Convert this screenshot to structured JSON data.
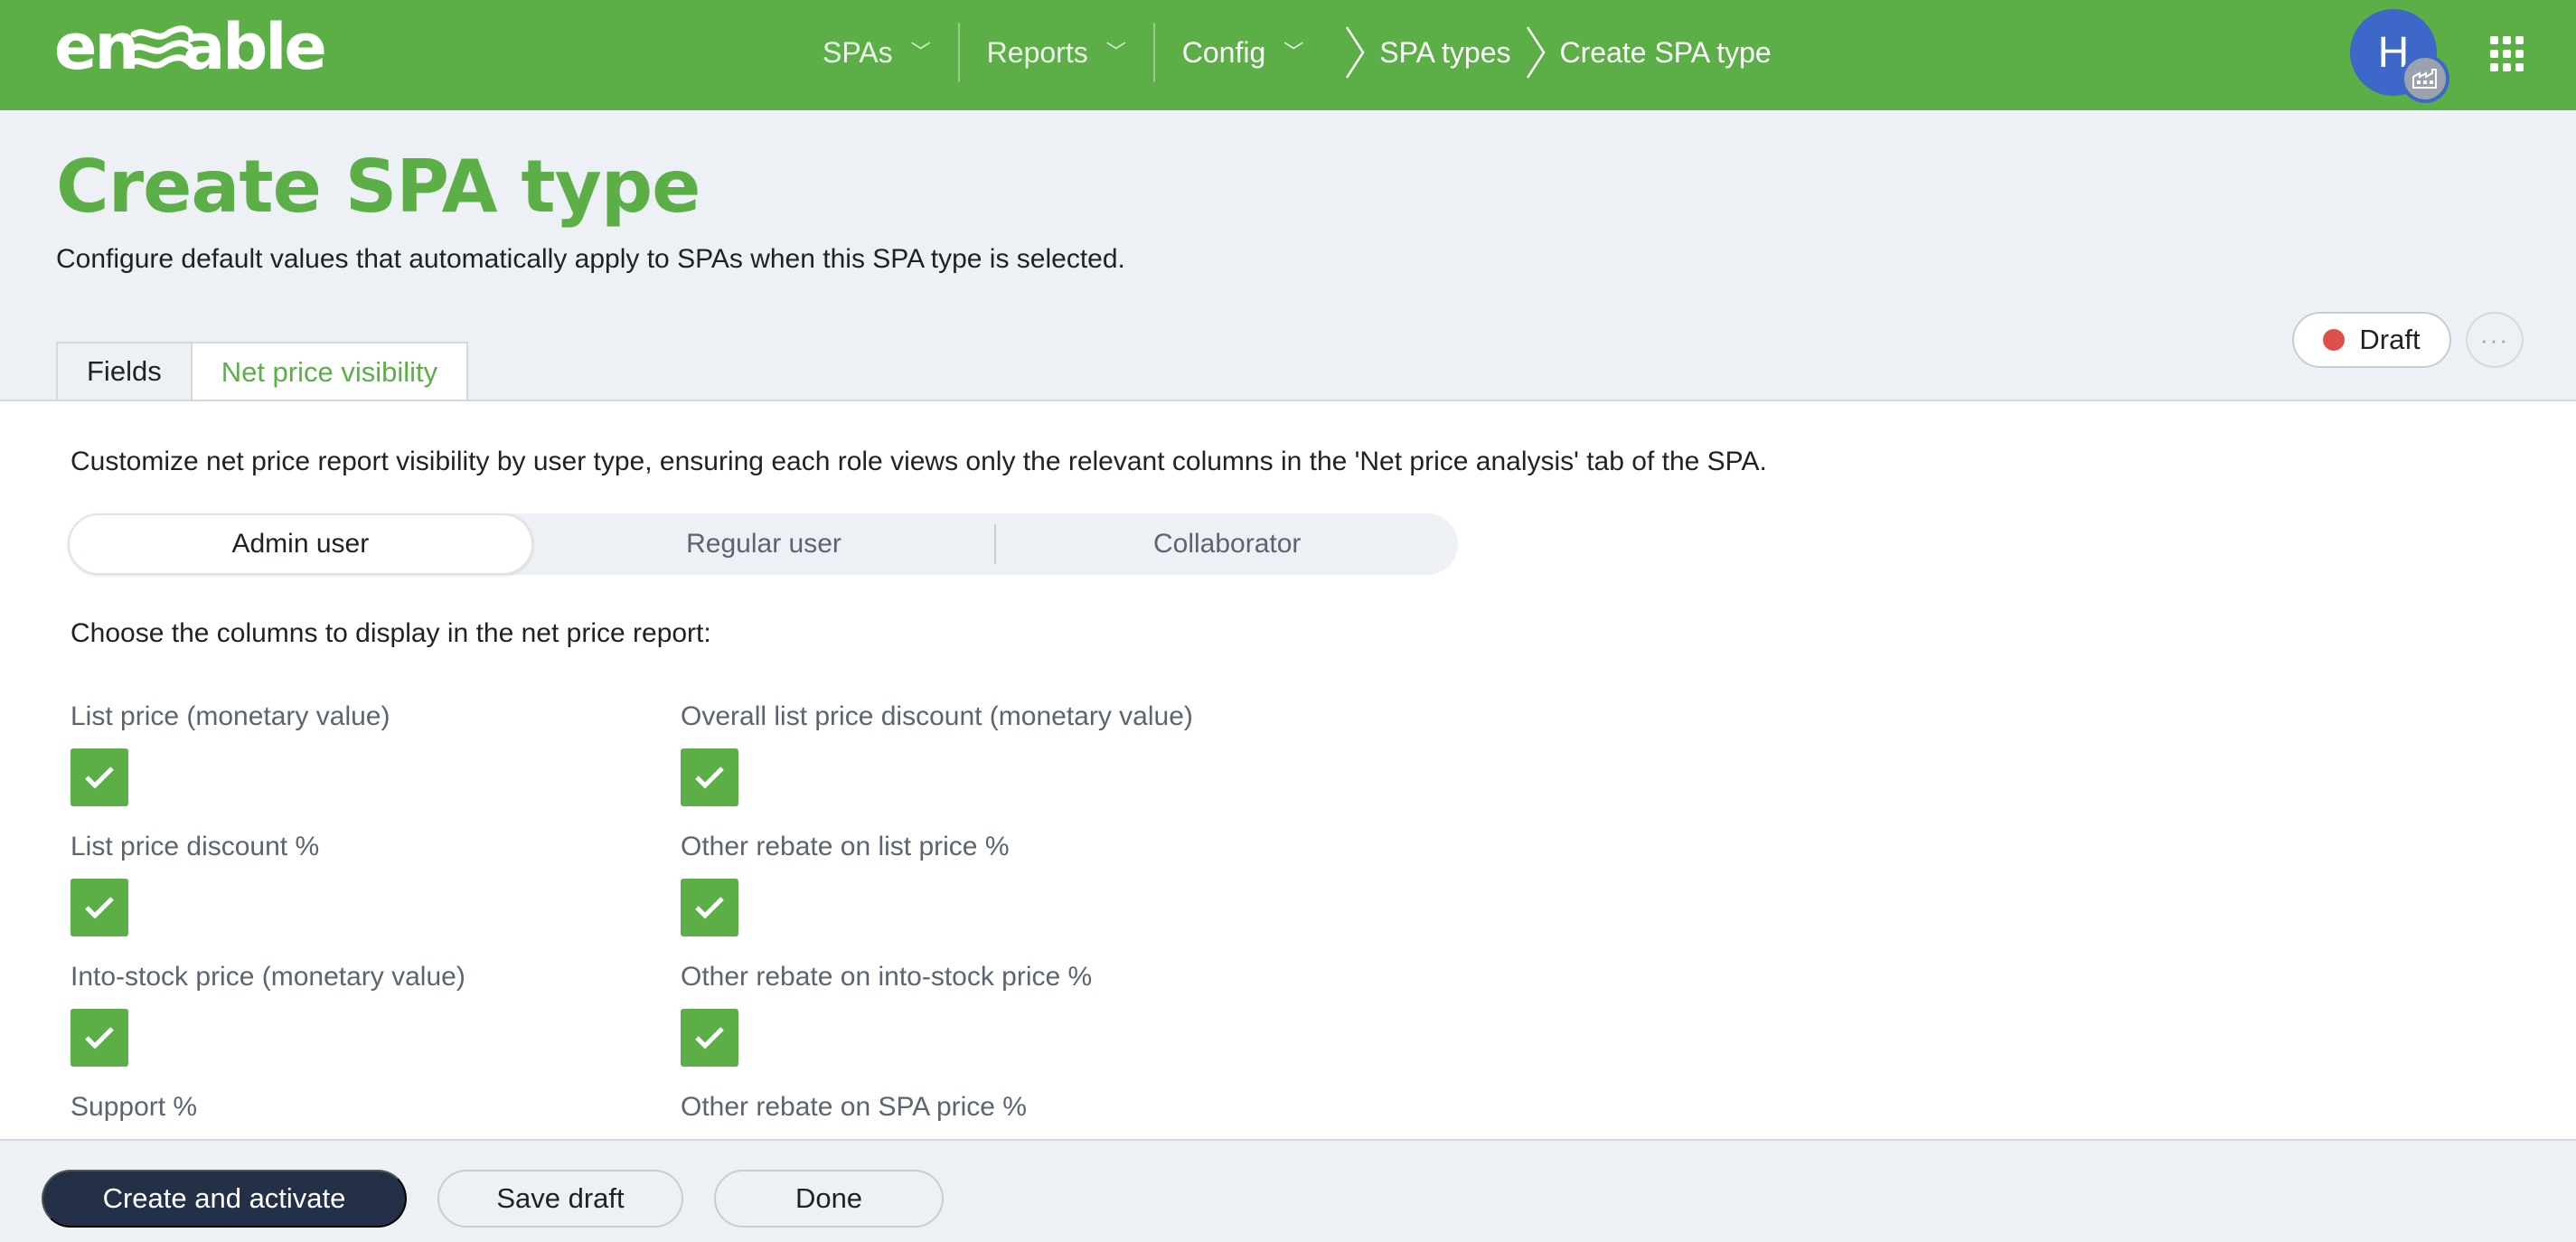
{
  "app": {
    "logo_text": "enable"
  },
  "nav": {
    "items": [
      {
        "label": "SPAs"
      },
      {
        "label": "Reports"
      },
      {
        "label": "Config"
      }
    ],
    "breadcrumb": [
      "SPA types",
      "Create SPA type"
    ],
    "chevron_glyph": "﹀"
  },
  "user": {
    "avatar_initial": "H"
  },
  "page": {
    "title": "Create SPA type",
    "subtitle": "Configure default values that automatically apply to SPAs when this SPA type is selected."
  },
  "tabs": [
    {
      "label": "Fields",
      "active": false
    },
    {
      "label": "Net price visibility",
      "active": true
    }
  ],
  "status": {
    "label": "Draft",
    "color": "#e0504a"
  },
  "panel": {
    "intro": "Customize net price report visibility by user type, ensuring each role views only the relevant columns in the 'Net price analysis' tab of the SPA.",
    "user_types": [
      {
        "label": "Admin user",
        "selected": true
      },
      {
        "label": "Regular user",
        "selected": false
      },
      {
        "label": "Collaborator",
        "selected": false
      }
    ],
    "choose_label": "Choose the columns to display in the net price report:",
    "columns": [
      {
        "label": "List price (monetary value)",
        "checked": true
      },
      {
        "label": "Overall list price discount (monetary value)",
        "checked": true
      },
      {
        "label": "List price discount %",
        "checked": true
      },
      {
        "label": "Other rebate on list price %",
        "checked": true
      },
      {
        "label": "Into-stock price (monetary value)",
        "checked": true
      },
      {
        "label": "Other rebate on into-stock price %",
        "checked": true
      },
      {
        "label": "Support %",
        "checked": true
      },
      {
        "label": "Other rebate on SPA price %",
        "checked": true
      }
    ]
  },
  "footer": {
    "primary": "Create and activate",
    "save_draft": "Save draft",
    "done": "Done"
  },
  "colors": {
    "brand_green": "#5caf47",
    "primary_button": "#243047",
    "avatar": "#3d67c9"
  }
}
